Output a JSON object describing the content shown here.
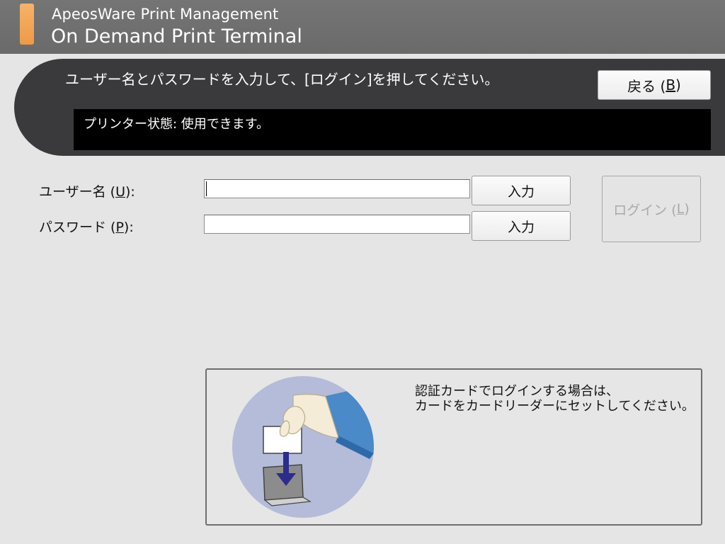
{
  "titlebar": {
    "app_name": "ApeosWare Print Management",
    "subtitle": "On Demand Print Terminal",
    "accent_color": "#f0a050"
  },
  "instruction": {
    "text": "ユーザー名とパスワードを入力して、[ログイン]を押してください。"
  },
  "back_button": {
    "label": "戻る (",
    "mnemonic": "B",
    "suffix": ")"
  },
  "status": {
    "text": "プリンター状態: 使用できます。"
  },
  "form": {
    "username": {
      "label": "ユーザー名 (",
      "mnemonic": "U",
      "suffix": "):",
      "value": "",
      "button_label": "入力"
    },
    "password": {
      "label": "パスワード (",
      "mnemonic": "P",
      "suffix": "):",
      "value": "",
      "button_label": "入力"
    }
  },
  "login_button": {
    "label": "ログイン (",
    "mnemonic": "L",
    "suffix": ")",
    "enabled": false
  },
  "card_info": {
    "line1": "認証カードでログインする場合は、",
    "line2": "カードをカードリーダーにセットしてください。",
    "illustration": "card-reader-illustration"
  },
  "colors": {
    "background": "#e5e5e5",
    "titlebar": "#707070",
    "panel": "#3a3a3c",
    "status_box": "#000000",
    "illustration_circle": "#b4bcd9",
    "arrow": "#2c2c8c",
    "sleeve": "#4a8ac8"
  }
}
